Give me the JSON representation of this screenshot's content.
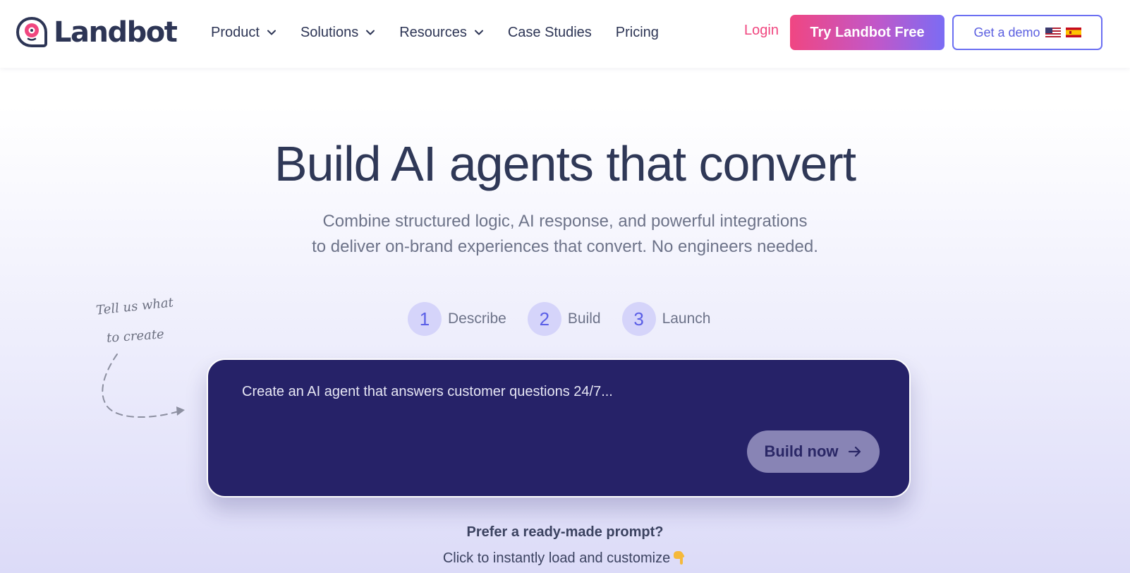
{
  "header": {
    "brand": "Landbot",
    "nav": [
      {
        "label": "Product",
        "dropdown": true
      },
      {
        "label": "Solutions",
        "dropdown": true
      },
      {
        "label": "Resources",
        "dropdown": true
      },
      {
        "label": "Case Studies",
        "dropdown": false
      },
      {
        "label": "Pricing",
        "dropdown": false
      }
    ],
    "login_label": "Login",
    "try_label": "Try Landbot Free",
    "demo_label": "Get a demo",
    "demo_flags": [
      "us-flag-icon",
      "es-flag-icon"
    ]
  },
  "hero": {
    "title": "Build AI agents that convert",
    "subtitle_line1": "Combine structured logic, AI response, and powerful integrations",
    "subtitle_line2": "to deliver on-brand experiences that convert. No engineers needed."
  },
  "note": {
    "line1": "Tell us what",
    "line2": "to create"
  },
  "steps": [
    {
      "number": "1",
      "label": "Describe"
    },
    {
      "number": "2",
      "label": "Build"
    },
    {
      "number": "3",
      "label": "Launch"
    }
  ],
  "prompt": {
    "placeholder": "Create an AI agent that answers customer questions 24/7...",
    "build_label": "Build now"
  },
  "ready": {
    "title": "Prefer a ready-made prompt?",
    "subtitle": "Click to instantly load and customize"
  },
  "colors": {
    "brand_pink": "#f0467f",
    "brand_purple": "#6b6ff2",
    "prompt_bg": "#262268",
    "text_dark": "#2f3857"
  }
}
